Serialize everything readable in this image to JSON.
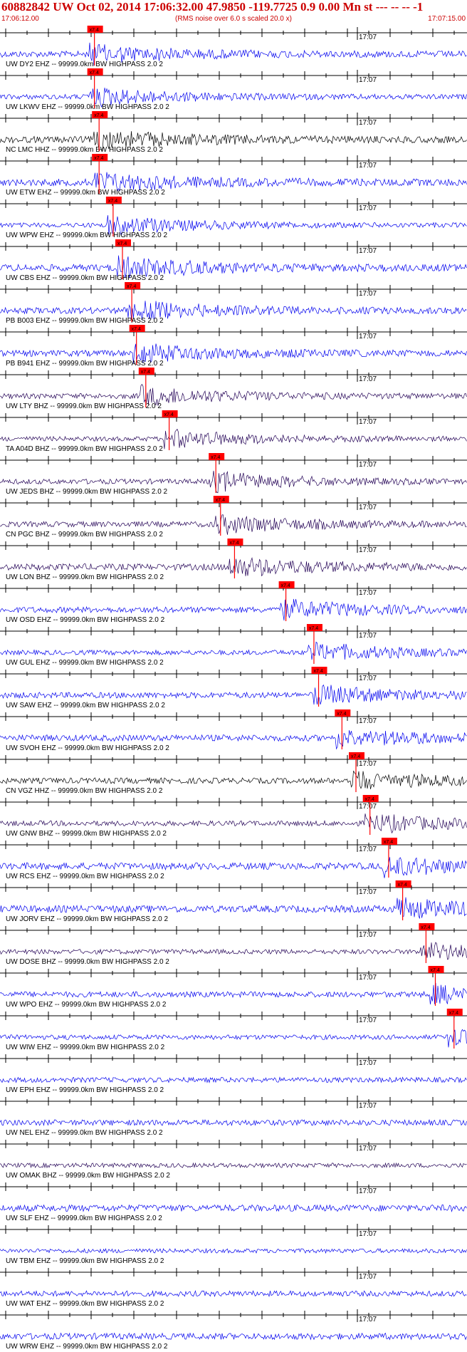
{
  "header": {
    "title": "60882842 UW Oct 02, 2014 17:06:32.00   47.9850 -119.7725  0.9 0.00 Mn st --- -- --   -1",
    "start_time": "17:06:12.00",
    "rms_note": "(RMS noise over 6.0 s scaled 20.0 x)",
    "end_time": "17:07:15.00"
  },
  "time_marker_label": "17:07",
  "pick_label": "x7.4",
  "colors": {
    "header_text": "#cc0000",
    "pick": "#ff0000",
    "blue": "#0000ee",
    "black": "#000000",
    "navy": "#220055"
  },
  "traces": [
    {
      "label": "UW DY2 EHZ -- 99999.0km BW  HIGHPASS  2.0  2",
      "color": "blue",
      "pick": 0.19
    },
    {
      "label": "UW LKWV EHZ -- 99999.0km BW  HIGHPASS  2.0  2",
      "color": "blue",
      "pick": 0.19
    },
    {
      "label": "NC LMC HHZ -- 99999.0km BW  HIGHPASS  2.0  2",
      "color": "black",
      "pick": 0.2
    },
    {
      "label": "UW ETW EHZ -- 99999.0km BW  HIGHPASS  2.0  2",
      "color": "blue",
      "pick": 0.2
    },
    {
      "label": "UW WPW EHZ -- 99999.0km BW  HIGHPASS  2.0  2",
      "color": "blue",
      "pick": 0.23
    },
    {
      "label": "UW CBS EHZ -- 99999.0km BW  HIGHPASS  2.0  2",
      "color": "blue",
      "pick": 0.25
    },
    {
      "label": "PB B003 EHZ -- 99999.0km BW  HIGHPASS  2.0  2",
      "color": "blue",
      "pick": 0.27
    },
    {
      "label": "PB B941 EHZ -- 99999.0km BW  HIGHPASS  2.0  2",
      "color": "blue",
      "pick": 0.28
    },
    {
      "label": "UW LTY BHZ -- 99999.0km BW  HIGHPASS  2.0  2",
      "color": "navy",
      "pick": 0.3
    },
    {
      "label": "TA A04D BHZ -- 99999.0km BW  HIGHPASS  2.0  2",
      "color": "navy",
      "pick": 0.35
    },
    {
      "label": "UW JEDS BHZ -- 99999.0km BW  HIGHPASS  2.0  2",
      "color": "navy",
      "pick": 0.45
    },
    {
      "label": "CN PGC BHZ -- 99999.0km BW  HIGHPASS  2.0  2",
      "color": "navy",
      "pick": 0.46
    },
    {
      "label": "UW LON BHZ -- 99999.0km BW  HIGHPASS  2.0  2",
      "color": "navy",
      "pick": 0.49
    },
    {
      "label": "UW OSD EHZ -- 99999.0km BW  HIGHPASS  2.0  2",
      "color": "blue",
      "pick": 0.6
    },
    {
      "label": "UW GUL EHZ -- 99999.0km BW  HIGHPASS  2.0  2",
      "color": "blue",
      "pick": 0.66
    },
    {
      "label": "UW SAW EHZ -- 99999.0km BW  HIGHPASS  2.0  2",
      "color": "blue",
      "pick": 0.67
    },
    {
      "label": "UW SVOH EHZ -- 99999.0km BW  HIGHPASS  2.0  2",
      "color": "blue",
      "pick": 0.72
    },
    {
      "label": "CN VGZ HHZ -- 99999.0km BW  HIGHPASS  2.0  2",
      "color": "black",
      "pick": 0.75
    },
    {
      "label": "UW GNW BHZ -- 99999.0km BW  HIGHPASS  2.0  2",
      "color": "navy",
      "pick": 0.78
    },
    {
      "label": "UW RCS EHZ -- 99999.0km BW  HIGHPASS  2.0  2",
      "color": "blue",
      "pick": 0.82
    },
    {
      "label": "UW JORV EHZ -- 99999.0km BW  HIGHPASS  2.0  2",
      "color": "blue",
      "pick": 0.85
    },
    {
      "label": "UW DOSE BHZ -- 99999.0km BW  HIGHPASS  2.0  2",
      "color": "navy",
      "pick": 0.9
    },
    {
      "label": "UW WPO EHZ -- 99999.0km BW  HIGHPASS  2.0  2",
      "color": "blue",
      "pick": 0.92
    },
    {
      "label": "UW WIW EHZ -- 99999.0km BW  HIGHPASS  2.0  2",
      "color": "blue",
      "pick": 0.96
    },
    {
      "label": "UW EPH EHZ -- 99999.0km BW  HIGHPASS  2.0  2",
      "color": "blue",
      "pick": null
    },
    {
      "label": "UW NEL EHZ -- 99999.0km BW  HIGHPASS  2.0  2",
      "color": "blue",
      "pick": null
    },
    {
      "label": "UW OMAK BHZ -- 99999.0km BW  HIGHPASS  2.0  2",
      "color": "navy",
      "pick": null
    },
    {
      "label": "UW SLF EHZ -- 99999.0km BW  HIGHPASS  2.0  2",
      "color": "blue",
      "pick": null
    },
    {
      "label": "UW TBM EHZ -- 99999.0km BW  HIGHPASS  2.0  2",
      "color": "blue",
      "pick": null
    },
    {
      "label": "UW WAT EHZ -- 99999.0km BW  HIGHPASS  2.0  2",
      "color": "blue",
      "pick": null
    },
    {
      "label": "UW WRW EHZ -- 99999.0km BW  HIGHPASS  2.0  2",
      "color": "blue",
      "pick": null
    }
  ]
}
